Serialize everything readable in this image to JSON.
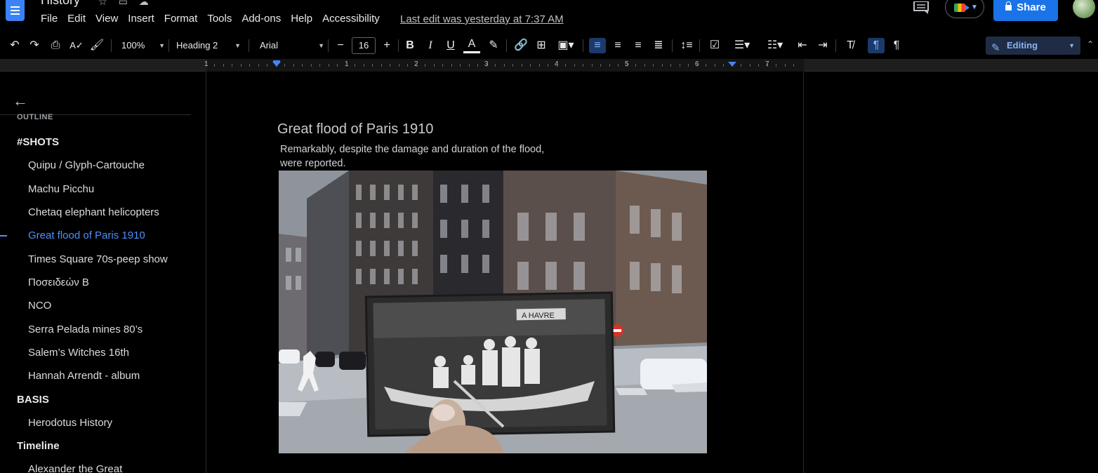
{
  "app": {
    "doc_title": "History",
    "last_edit": "Last edit was yesterday at 7:37 AM",
    "share_label": "Share"
  },
  "menu": [
    "File",
    "Edit",
    "View",
    "Insert",
    "Format",
    "Tools",
    "Add-ons",
    "Help",
    "Accessibility"
  ],
  "toolbar": {
    "zoom": "100%",
    "style": "Heading 2",
    "font": "Arial",
    "font_size": "16",
    "bold": "B",
    "italic": "I",
    "underline": "U",
    "text_color": "A",
    "editing_mode": "Editing"
  },
  "ruler": {
    "numbers": [
      "1",
      "1",
      "2",
      "3",
      "4",
      "5",
      "6",
      "7"
    ]
  },
  "outline": {
    "heading": "OUTLINE",
    "items": [
      {
        "label": "#SHOTS",
        "level": 1
      },
      {
        "label": "Quipu / Glyph-Cartouche",
        "level": 2
      },
      {
        "label": "Machu Picchu",
        "level": 2
      },
      {
        "label": "Chetaq elephant helicopters",
        "level": 2
      },
      {
        "label": "Great flood of Paris 1910",
        "level": 2,
        "active": true
      },
      {
        "label": "Times Square 70s-peep show",
        "level": 2
      },
      {
        "label": "Ποσειδεών Β",
        "level": 2
      },
      {
        "label": "NCO",
        "level": 2
      },
      {
        "label": "Serra Pelada mines 80’s",
        "level": 2
      },
      {
        "label": "Salem’s Witches 16th",
        "level": 2
      },
      {
        "label": "Hannah Arrendt - album",
        "level": 2
      },
      {
        "label": "BASIS",
        "level": 1
      },
      {
        "label": "Herodotus History",
        "level": 2
      },
      {
        "label": "Timeline",
        "level": 1
      },
      {
        "label": "Alexander the Great",
        "level": 2
      }
    ]
  },
  "document": {
    "heading": "Great flood of Paris 1910",
    "paragraph_line1": "Remarkably, despite the damage and duration of the flood,",
    "paragraph_line2": "were reported.",
    "image_sign": "A HAVRE"
  },
  "colors": {
    "accent": "#1a73e8",
    "active_outline": "#4d90fe",
    "background": "#000000"
  }
}
